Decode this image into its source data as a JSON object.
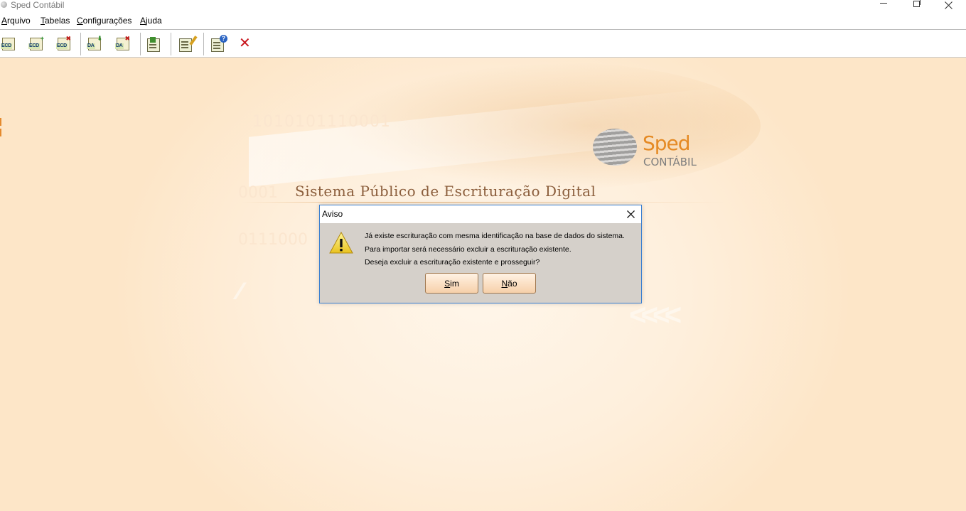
{
  "window": {
    "title": "Sped Contábil",
    "icons": {
      "app": "sped-app-icon",
      "minimize": "minimize-icon",
      "restore": "restore-icon",
      "close": "close-icon"
    }
  },
  "menu": {
    "items": [
      {
        "label": "Arquivo"
      },
      {
        "label": "Tabelas"
      },
      {
        "label": "Configurações"
      },
      {
        "label": "Ajuda"
      }
    ]
  },
  "toolbar": {
    "buttons": [
      {
        "icon": "ecd-open-icon",
        "tag": "ECD"
      },
      {
        "icon": "ecd-new-icon",
        "tag": "ECD"
      },
      {
        "icon": "ecd-delete-icon",
        "tag": "ECD"
      },
      {
        "icon": "da-import-icon",
        "tag": "DA"
      },
      {
        "icon": "da-delete-icon",
        "tag": "DA"
      },
      {
        "icon": "export-icon"
      },
      {
        "icon": "edit-settings-icon"
      },
      {
        "icon": "help-icon"
      },
      {
        "icon": "exit-icon"
      }
    ]
  },
  "banner": {
    "binary_1": "1010101110001",
    "binary_2": "0001",
    "binary_3": "0111000",
    "tagline": "Sistema Público de Escrituração Digital",
    "logo_name": "Sped",
    "logo_sub": "CONTÁBIL",
    "colors": {
      "logo_orange": "#e58a25",
      "background": "#fde6c8"
    }
  },
  "dialog": {
    "title": "Aviso",
    "icon": "warning-icon",
    "lines": [
      "Já existe escrituração com mesma identificação na base de dados do sistema.",
      "Para importar será necessário excluir a escrituração existente.",
      "Deseja excluir a escrituração existente e prosseguir?"
    ],
    "yes_label_first": "S",
    "yes_label_rest": "im",
    "no_label_first": "N",
    "no_label_rest": "ão"
  }
}
